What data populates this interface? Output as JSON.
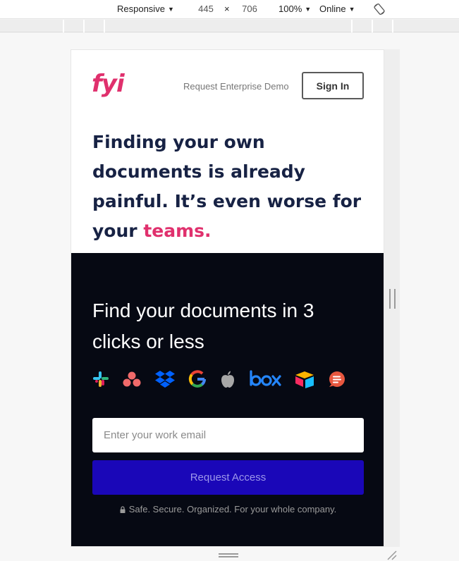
{
  "devtools": {
    "device_mode": "Responsive",
    "width": "445",
    "times": "×",
    "height": "706",
    "zoom": "100%",
    "network": "Online"
  },
  "header": {
    "logo_text": "fyi",
    "demo_link": "Request Enterprise Demo",
    "signin_label": "Sign In"
  },
  "hero": {
    "headline": "Finding your own documents is already painful. It’s even worse for your ",
    "headline_accent": "teams."
  },
  "cta": {
    "title": "Find your documents in 3 clicks or less",
    "integrations": [
      "slack-icon",
      "asana-icon",
      "dropbox-icon",
      "google-icon",
      "apple-icon",
      "box-icon",
      "airtable-icon",
      "chat-icon"
    ],
    "email_placeholder": "Enter your work email",
    "button_label": "Request Access",
    "safe_text": "Safe. Secure. Organized. For your whole company."
  },
  "colors": {
    "brand": "#e0306d",
    "headline": "#172244",
    "dark_bg": "#060913",
    "button": "#1a07b8"
  }
}
